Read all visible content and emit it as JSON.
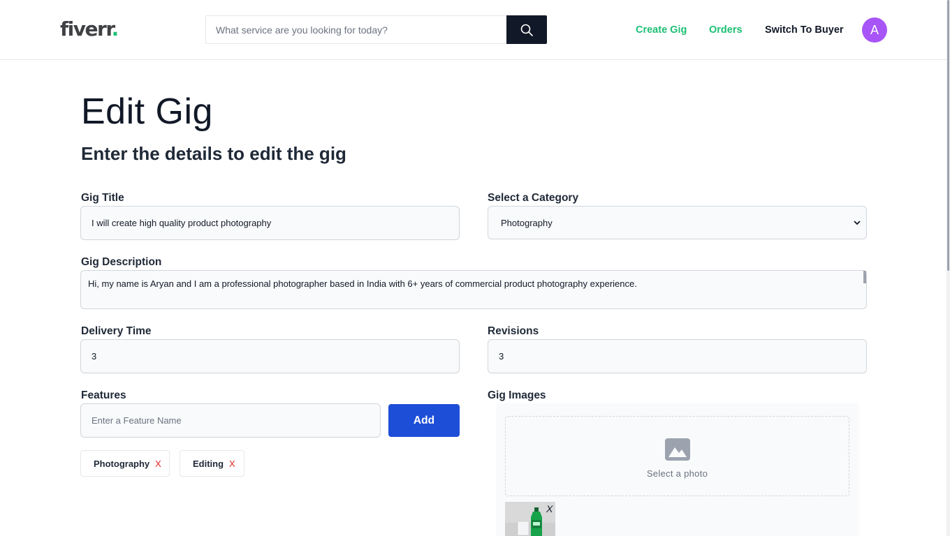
{
  "header": {
    "logo_text": "fiverr",
    "logo_dot": ".",
    "search": {
      "placeholder": "What service are you looking for today?",
      "value": ""
    },
    "nav": {
      "create_gig": "Create Gig",
      "orders": "Orders",
      "switch_to_buyer": "Switch To Buyer"
    },
    "avatar_initial": "A",
    "avatar_color": "#a855f7",
    "brand_green": "#1dbf73"
  },
  "page": {
    "title": "Edit Gig",
    "subtitle": "Enter the details to edit the gig"
  },
  "form": {
    "gig_title": {
      "label": "Gig Title",
      "value": "I will create high quality product photography"
    },
    "category": {
      "label": "Select a Category",
      "selected": "Photography"
    },
    "description": {
      "label": "Gig Description",
      "value": "Hi, my name is Aryan and I am a professional photographer based in India with 6+ years of commercial product photography experience."
    },
    "delivery_time": {
      "label": "Delivery Time",
      "value": "3"
    },
    "revisions": {
      "label": "Revisions",
      "value": "3"
    },
    "features": {
      "label": "Features",
      "placeholder": "Enter a Feature Name",
      "add_label": "Add",
      "items": [
        {
          "name": "Photography",
          "remove": "X"
        },
        {
          "name": "Editing",
          "remove": "X"
        }
      ]
    },
    "images": {
      "label": "Gig Images",
      "select_text": "Select a photo",
      "remove_label": "X"
    }
  },
  "colors": {
    "primary_button": "#1d4ed8",
    "remove_red": "#dc2626"
  }
}
